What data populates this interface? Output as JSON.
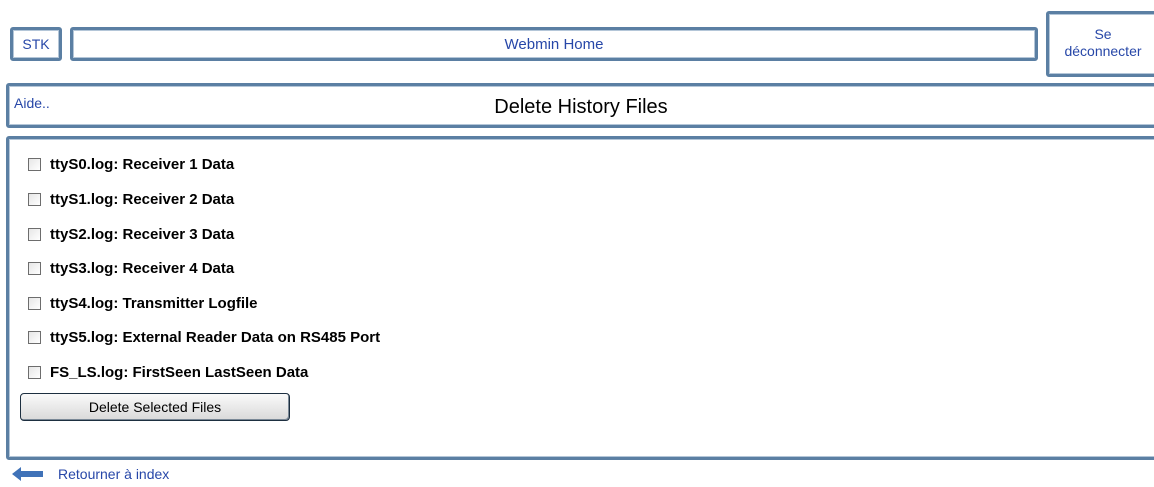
{
  "nav": {
    "stk_label": "STK",
    "home_label": "Webmin Home",
    "logout_line1": "Se",
    "logout_line2": "déconnecter"
  },
  "header": {
    "help_label": "Aide..",
    "title": "Delete History Files"
  },
  "files": [
    {
      "label": "ttyS0.log: Receiver 1 Data",
      "checked": false
    },
    {
      "label": "ttyS1.log: Receiver 2 Data",
      "checked": false
    },
    {
      "label": "ttyS2.log: Receiver 3 Data",
      "checked": false
    },
    {
      "label": "ttyS3.log: Receiver 4 Data",
      "checked": false
    },
    {
      "label": "ttyS4.log: Transmitter Logfile",
      "checked": false
    },
    {
      "label": "ttyS5.log: External Reader Data on RS485 Port",
      "checked": false
    },
    {
      "label": "FS_LS.log: FirstSeen LastSeen Data",
      "checked": false
    }
  ],
  "actions": {
    "delete_label": "Delete Selected Files"
  },
  "footer": {
    "back_label": "Retourner à index",
    "back_icon": "arrow-left-icon"
  },
  "colors": {
    "border": "#5b7fa3",
    "link": "#2747a8"
  }
}
